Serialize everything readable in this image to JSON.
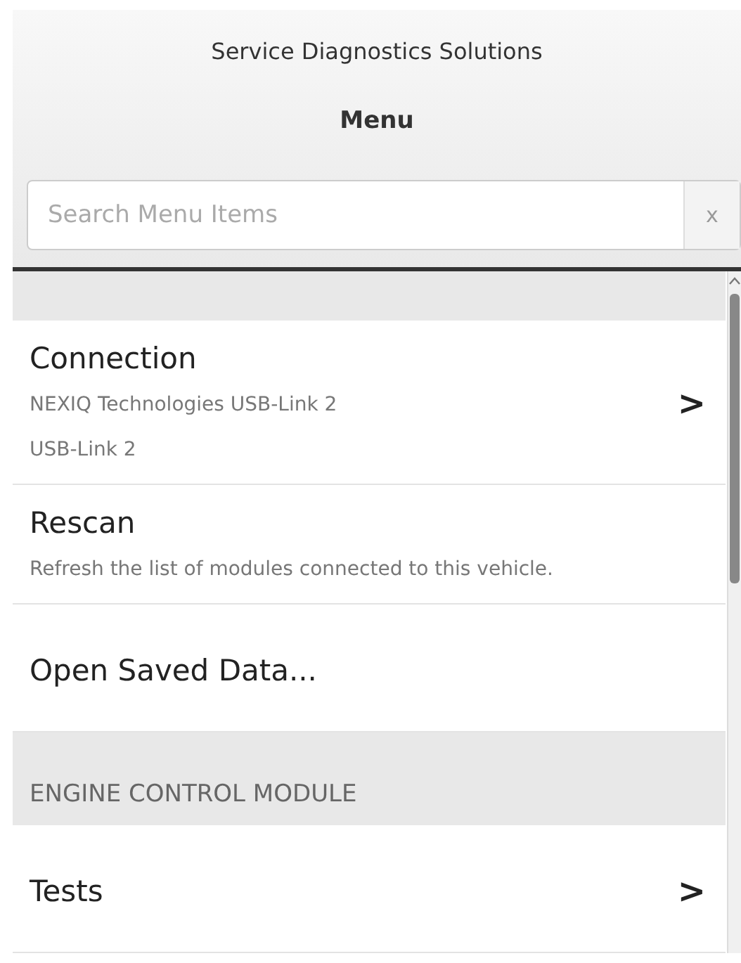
{
  "header": {
    "app_title": "Service Diagnostics Solutions",
    "title": "Menu"
  },
  "search": {
    "placeholder": "Search Menu Items",
    "clear": "x"
  },
  "menu": [
    {
      "kind": "item",
      "title": "Connection",
      "lines": [
        "NEXIQ Technologies USB-Link 2",
        "USB-Link 2"
      ],
      "chevron": ">"
    },
    {
      "kind": "item",
      "title": "Rescan",
      "lines": [
        "Refresh the list of modules connected to this vehicle."
      ]
    },
    {
      "kind": "item",
      "title": "Open Saved Data..."
    },
    {
      "kind": "section",
      "title": "ENGINE CONTROL MODULE"
    },
    {
      "kind": "item",
      "title": "Tests",
      "chevron": ">"
    }
  ]
}
